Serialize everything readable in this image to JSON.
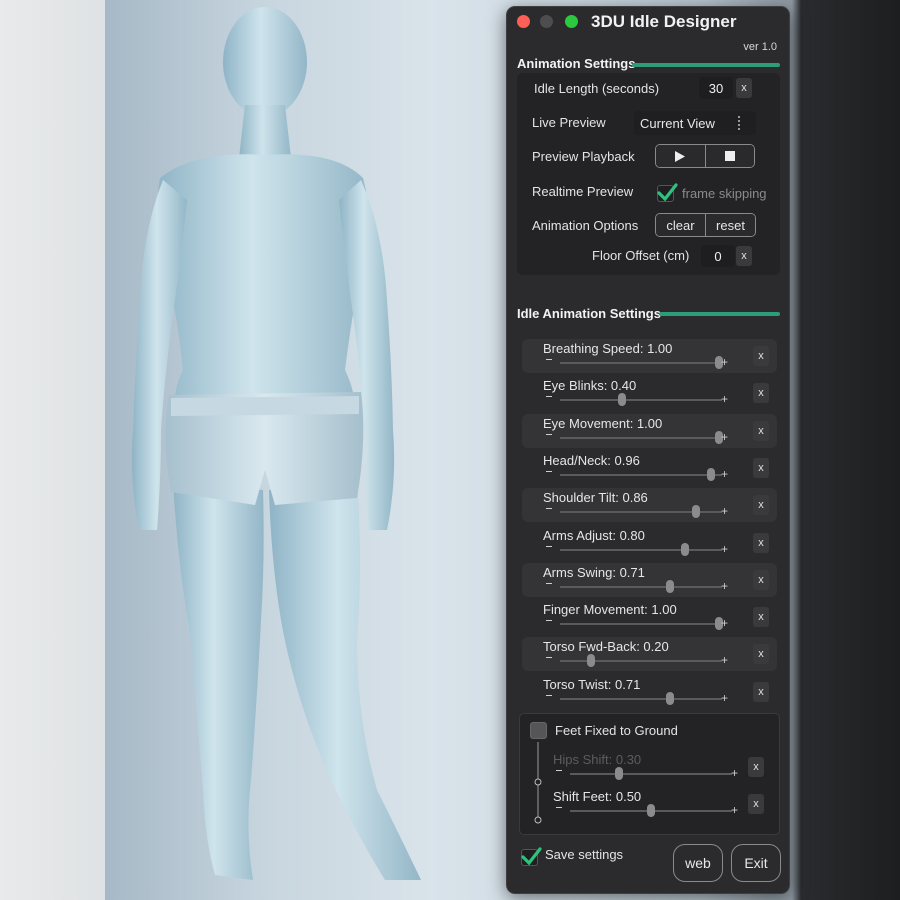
{
  "window": {
    "title": "3DU Idle Designer",
    "version": "ver 1.0"
  },
  "animation_settings": {
    "heading": "Animation Settings",
    "idle_length": {
      "label": "Idle Length (seconds)",
      "value": "30"
    },
    "live_preview": {
      "label": "Live Preview",
      "selected": "Current View"
    },
    "preview_playback": {
      "label": "Preview Playback",
      "play_icon": "play-icon",
      "stop_icon": "stop-icon"
    },
    "realtime_preview": {
      "label": "Realtime Preview",
      "checkbox_label": "frame skipping",
      "checked": true
    },
    "animation_options": {
      "label": "Animation Options",
      "clear": "clear",
      "reset": "reset"
    },
    "floor_offset": {
      "label": "Floor Offset (cm)",
      "value": "0"
    },
    "clear_x": "x"
  },
  "idle_settings": {
    "heading": "Idle Animation Settings",
    "sliders": [
      {
        "label": "Breathing Speed: 1.00",
        "level": 0.98
      },
      {
        "label": "Eye Blinks: 0.40",
        "level": 0.38
      },
      {
        "label": "Eye Movement: 1.00",
        "level": 0.98
      },
      {
        "label": "Head/Neck: 0.96",
        "level": 0.93
      },
      {
        "label": "Shoulder Tilt: 0.86",
        "level": 0.84
      },
      {
        "label": "Arms Adjust: 0.80",
        "level": 0.77
      },
      {
        "label": "Arms Swing: 0.71",
        "level": 0.68
      },
      {
        "label": "Finger Movement: 1.00",
        "level": 0.98
      },
      {
        "label": "Torso Fwd-Back: 0.20",
        "level": 0.19
      },
      {
        "label": "Torso Twist: 0.71",
        "level": 0.68
      }
    ],
    "minus": "-",
    "plus": "+",
    "x": "x"
  },
  "feet": {
    "label": "Feet Fixed to Ground",
    "checked": false,
    "sliders": [
      {
        "label": "Hips Shift: 0.30",
        "level": 0.3,
        "disabled": true
      },
      {
        "label": "Shift Feet: 0.50",
        "level": 0.5,
        "disabled": false
      }
    ]
  },
  "footer": {
    "save_settings": "Save settings",
    "save_checked": true,
    "web": "web",
    "exit": "Exit"
  },
  "colors": {
    "accent": "#2e9c7a",
    "check": "#2ec27e",
    "close": "#fe5f57",
    "zoom": "#2bc840"
  }
}
